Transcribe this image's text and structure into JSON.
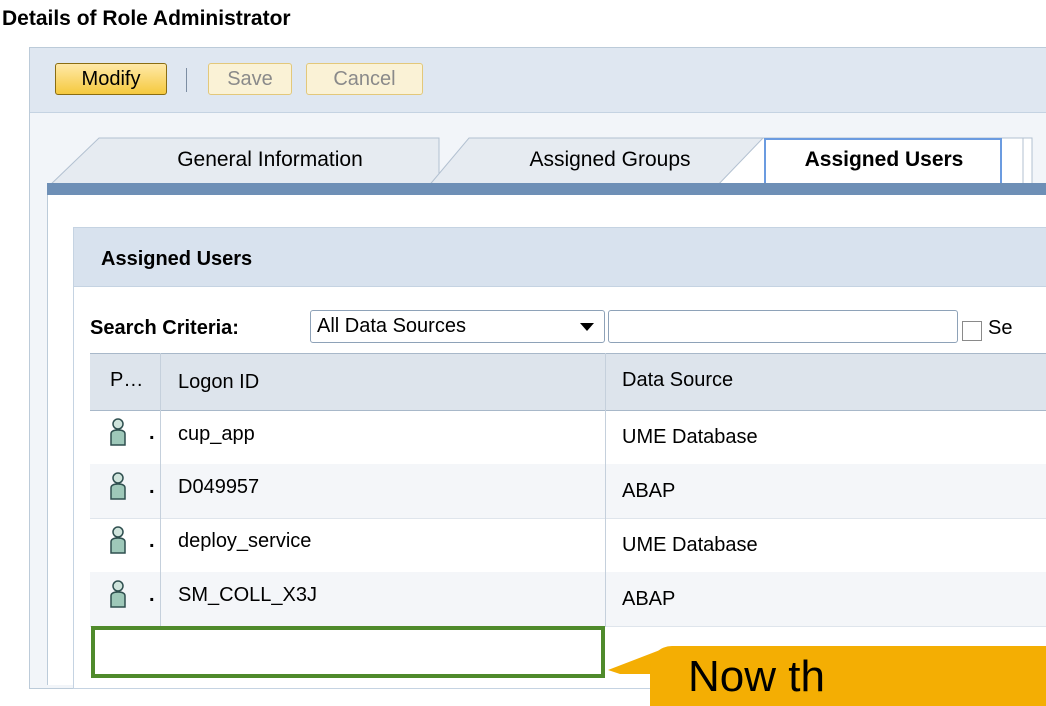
{
  "page": {
    "title": "Details of Role Administrator"
  },
  "toolbar": {
    "modify_label": "Modify",
    "save_label": "Save",
    "cancel_label": "Cancel"
  },
  "tabs": [
    {
      "label": "General Information",
      "selected": false
    },
    {
      "label": "Assigned Groups",
      "selected": false
    },
    {
      "label": "Assigned Users",
      "selected": true
    }
  ],
  "section": {
    "title": "Assigned Users"
  },
  "search": {
    "label": "Search Criteria:",
    "data_source_value": "All Data Sources",
    "query_value": "",
    "checkbox_label": "Se"
  },
  "table": {
    "columns": [
      "P…",
      "Logon ID",
      "Data Source"
    ],
    "rows": [
      {
        "icon": "user-icon",
        "marker": ".",
        "logon_id": "cup_app",
        "data_source": "UME Database"
      },
      {
        "icon": "user-icon",
        "marker": ".",
        "logon_id": "D049957",
        "data_source": "ABAP"
      },
      {
        "icon": "user-icon",
        "marker": ".",
        "logon_id": "deploy_service",
        "data_source": "UME Database"
      },
      {
        "icon": "user-icon",
        "marker": ".",
        "logon_id": "SM_COLL_X3J",
        "data_source": "ABAP"
      }
    ]
  },
  "callout": {
    "text": "Now th"
  },
  "colors": {
    "modify_button": "#f5c93e",
    "highlight_frame": "#4f8a2b",
    "callout": "#f4ae03",
    "tab_strip": "#6e8fb6"
  }
}
